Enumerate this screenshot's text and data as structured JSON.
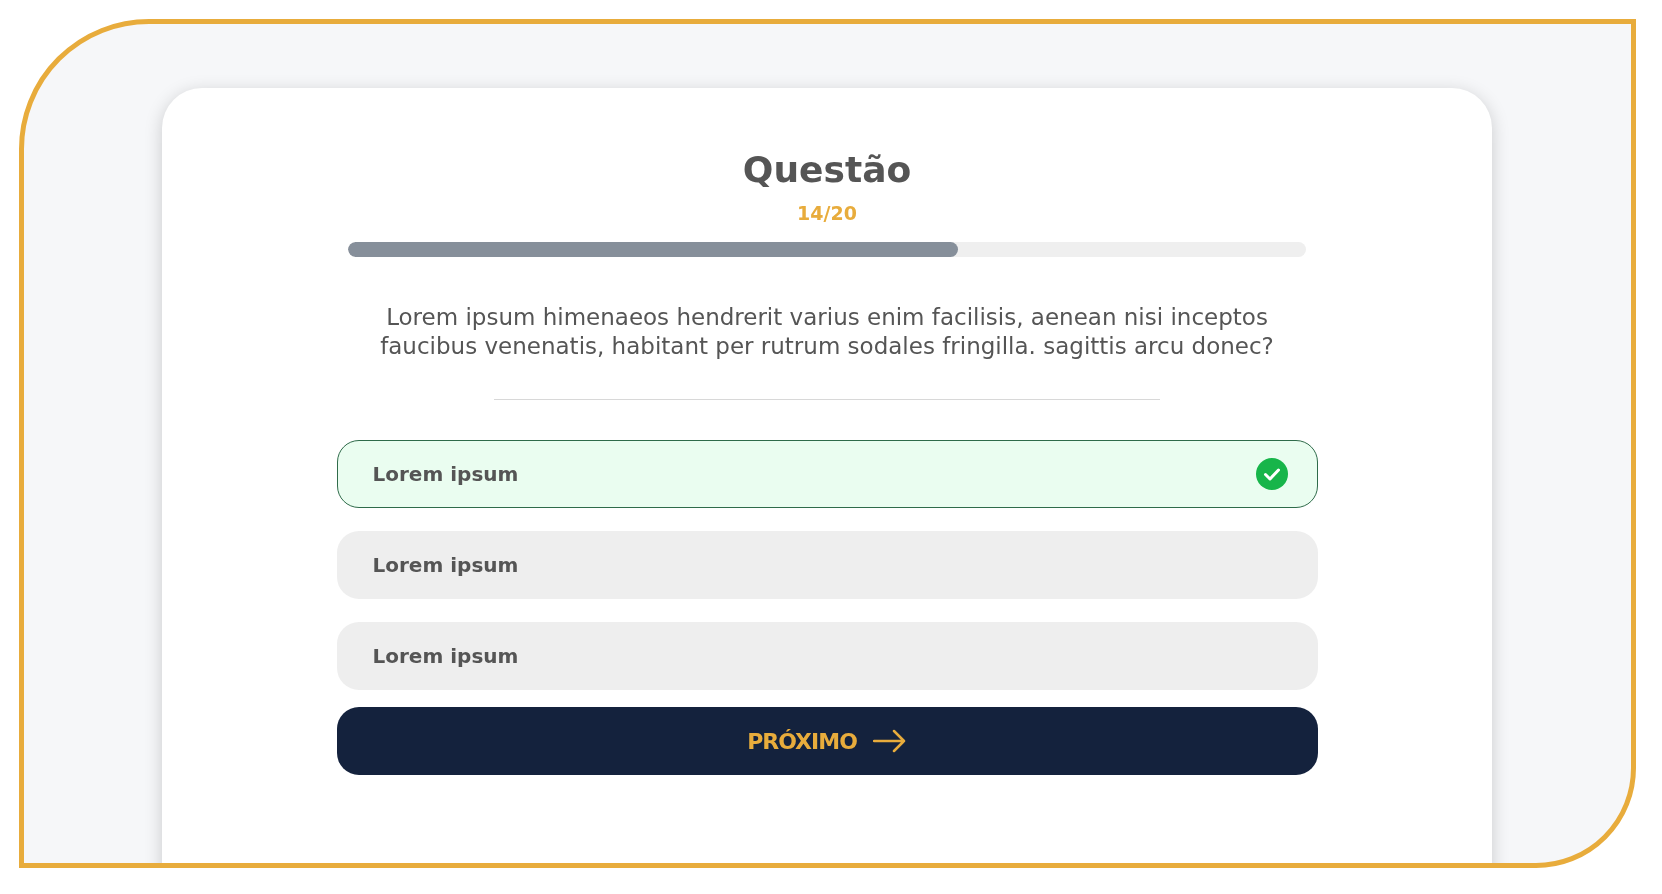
{
  "title": "Questão",
  "counter": "14/20",
  "progress": {
    "level": 0.637
  },
  "question": "Lorem ipsum himenaeos hendrerit varius enim facilisis, aenean nisi inceptos faucibus venenatis, habitant per rutrum sodales fringilla. sagittis arcu donec?",
  "options": [
    {
      "label": "Lorem ipsum",
      "selected": true
    },
    {
      "label": "Lorem ipsum",
      "selected": false
    },
    {
      "label": "Lorem ipsum",
      "selected": false
    }
  ],
  "next_button": "PRÓXIMO"
}
